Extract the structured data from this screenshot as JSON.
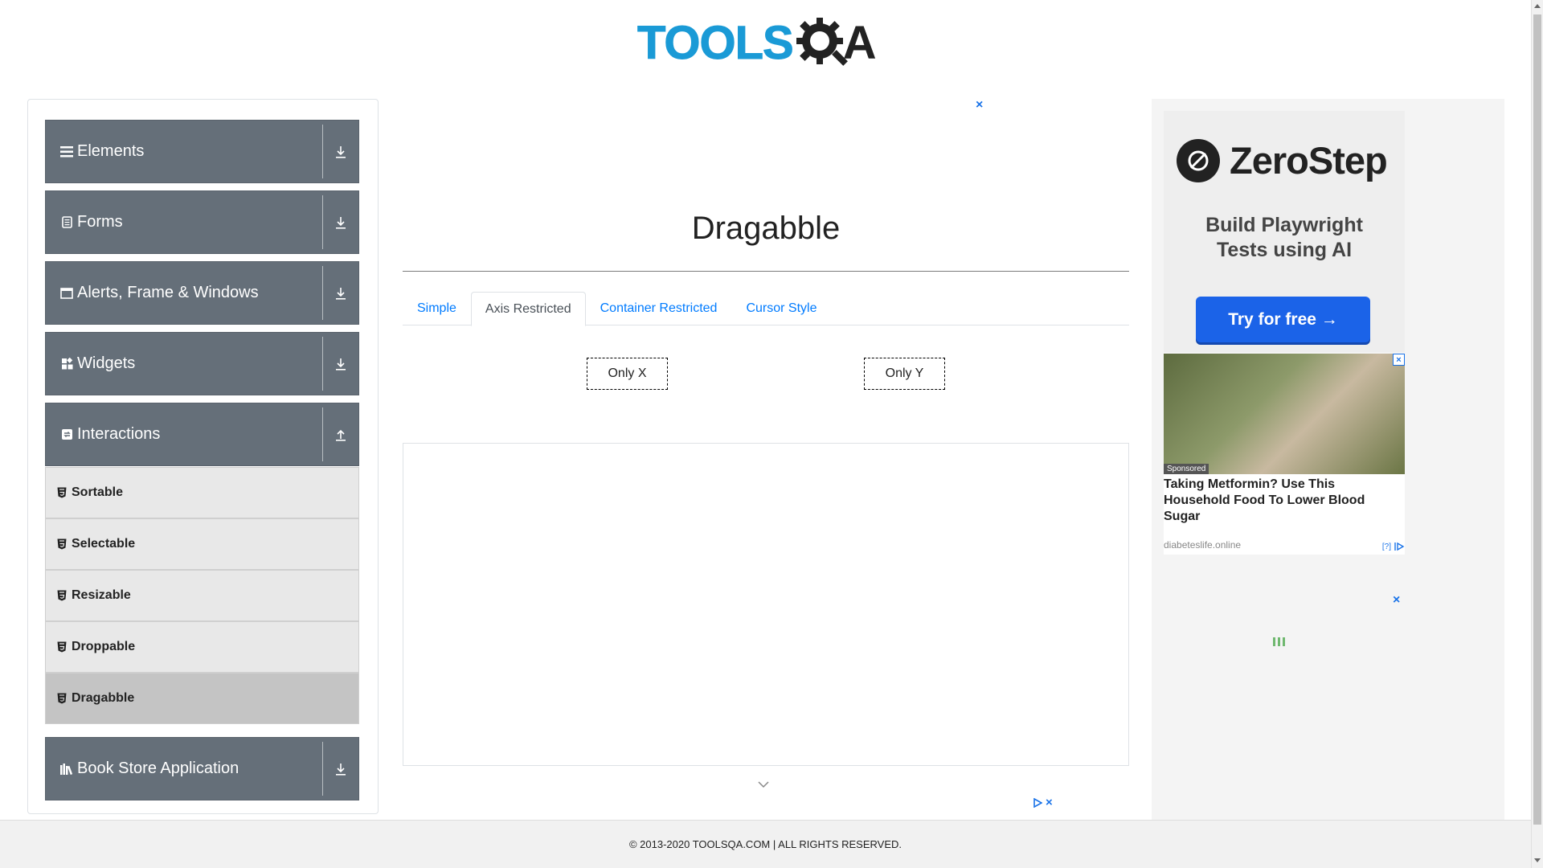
{
  "header": {
    "logo_tools": "TOOLS",
    "logo_a": "A"
  },
  "sidebar": {
    "groups": [
      {
        "label": "Elements",
        "icon": "hamburger-icon",
        "arrow": "download-arrow-icon"
      },
      {
        "label": "Forms",
        "icon": "document-icon",
        "arrow": "download-arrow-icon"
      },
      {
        "label": "Alerts, Frame & Windows",
        "icon": "window-icon",
        "arrow": "download-arrow-icon"
      },
      {
        "label": "Widgets",
        "icon": "widgets-icon",
        "arrow": "download-arrow-icon"
      },
      {
        "label": "Interactions",
        "icon": "interactions-icon",
        "arrow": "upload-arrow-icon",
        "expanded": true
      },
      {
        "label": "Book Store Application",
        "icon": "books-icon",
        "arrow": "download-arrow-icon"
      }
    ],
    "items": [
      {
        "label": "Sortable"
      },
      {
        "label": "Selectable"
      },
      {
        "label": "Resizable"
      },
      {
        "label": "Droppable"
      },
      {
        "label": "Dragabble",
        "active": true
      }
    ]
  },
  "main": {
    "title": "Dragabble",
    "tabs": [
      {
        "label": "Simple"
      },
      {
        "label": "Axis Restricted",
        "active": true
      },
      {
        "label": "Container Restricted"
      },
      {
        "label": "Cursor Style"
      }
    ],
    "drag_x_label": "Only X",
    "drag_y_label": "Only Y"
  },
  "ads": {
    "close_glyph": "×",
    "zerostep_name": "ZeroStep",
    "zerostep_tagline_1": "Build Playwright",
    "zerostep_tagline_2": "Tests using AI",
    "zerostep_cta": "Try for free →",
    "native_badge": "Sponsored",
    "native_headline": "Taking Metformin? Use This Household Food To Lower Blood Sugar",
    "native_source": "diabeteslife.online",
    "native_info": "[?]"
  },
  "footer": {
    "copyright": "© 2013-2020 TOOLSQA.COM | ALL RIGHTS RESERVED."
  },
  "colors": {
    "accent": "#007bff",
    "sidebar_header": "#656f79",
    "logo_blue": "#1a9ad6",
    "cta_blue": "#1b63e8"
  }
}
